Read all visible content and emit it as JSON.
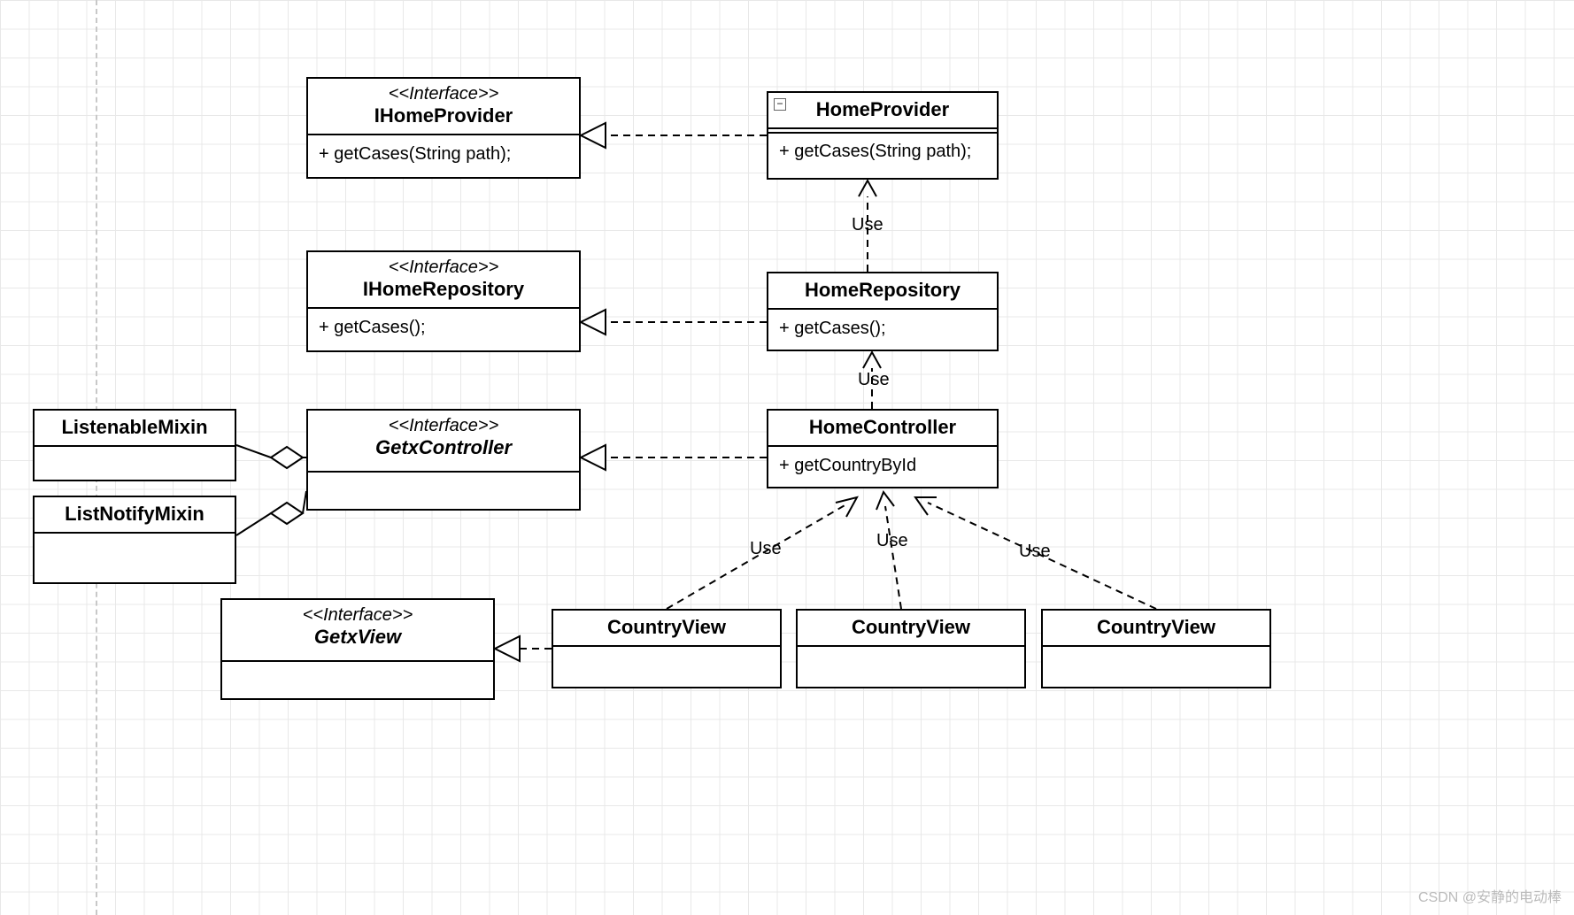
{
  "nodes": {
    "ihomeprovider": {
      "stereo": "<<Interface>>",
      "title": "IHomeProvider",
      "member": "+ getCases(String path);"
    },
    "homeprovider": {
      "title": "HomeProvider",
      "member": "+ getCases(String path);"
    },
    "ihomerepository": {
      "stereo": "<<Interface>>",
      "title": "IHomeRepository",
      "member": "+  getCases();"
    },
    "homerepository": {
      "title": "HomeRepository",
      "member": "+ getCases();"
    },
    "getxcontroller": {
      "stereo": "<<Interface>>",
      "title": "GetxController"
    },
    "homecontroller": {
      "title": "HomeController",
      "member": "+ getCountryById"
    },
    "listenablemixin": {
      "title": "ListenableMixin"
    },
    "listnotifymixin": {
      "title": "ListNotifyMixin"
    },
    "getxview": {
      "stereo": "<<Interface>>",
      "title": "GetxView"
    },
    "countryview1": {
      "title": "CountryView"
    },
    "countryview2": {
      "title": "CountryView"
    },
    "countryview3": {
      "title": "CountryView"
    }
  },
  "labels": {
    "use1": "Use",
    "use2": "Use",
    "use3": "Use",
    "use4": "Use",
    "use5": "Use"
  },
  "watermark": "CSDN @安静的电动棒"
}
